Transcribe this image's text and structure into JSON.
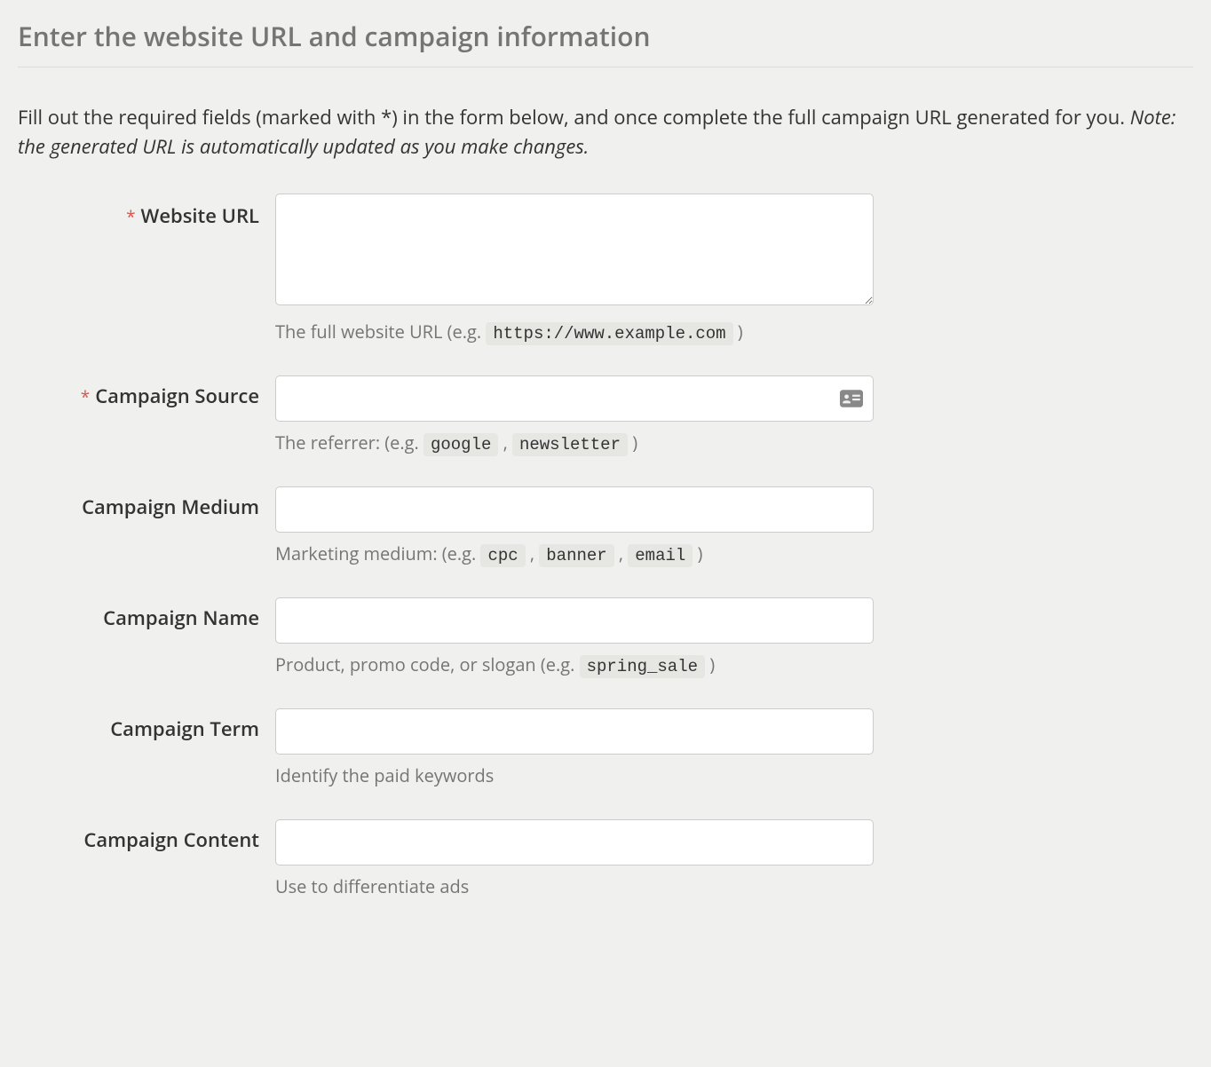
{
  "header": "Enter the website URL and campaign information",
  "intro": {
    "text_before": "Fill out the required fields (marked with *) in the form below, and once complete the full campaign URL generated for you. ",
    "note": "Note: the generated URL is automatically updated as you make changes."
  },
  "fields": {
    "website_url": {
      "label": "Website URL",
      "required": "*",
      "help_prefix": "The full website URL (e.g. ",
      "help_code1": "https://www.example.com",
      "help_suffix": " )"
    },
    "campaign_source": {
      "label": "Campaign Source",
      "required": "*",
      "help_prefix": "The referrer: (e.g. ",
      "help_code1": "google",
      "help_sep1": " , ",
      "help_code2": "newsletter",
      "help_suffix": " )"
    },
    "campaign_medium": {
      "label": "Campaign Medium",
      "help_prefix": "Marketing medium: (e.g. ",
      "help_code1": "cpc",
      "help_sep1": " , ",
      "help_code2": "banner",
      "help_sep2": " , ",
      "help_code3": "email",
      "help_suffix": " )"
    },
    "campaign_name": {
      "label": "Campaign Name",
      "help_prefix": "Product, promo code, or slogan (e.g. ",
      "help_code1": "spring_sale",
      "help_suffix": " )"
    },
    "campaign_term": {
      "label": "Campaign Term",
      "help": "Identify the paid keywords"
    },
    "campaign_content": {
      "label": "Campaign Content",
      "help": "Use to differentiate ads"
    }
  }
}
